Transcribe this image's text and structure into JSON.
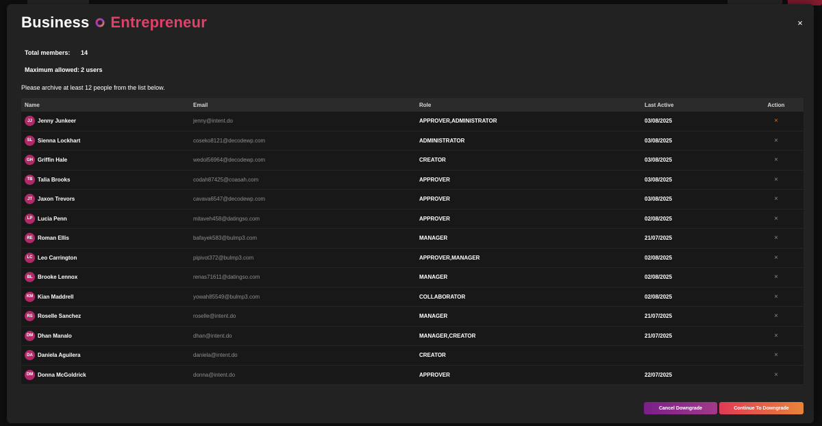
{
  "header": {
    "title_main": "Business",
    "title_accent": "Entrepreneur",
    "logo_icon": "ring-logo-icon",
    "close_label": "×"
  },
  "stats": {
    "total_label": "Total members:",
    "total_value": "14",
    "max_label": "Maximum allowed:",
    "max_value": "2 users"
  },
  "instruction": "Please archive at least 12 people from the list below.",
  "table": {
    "columns": {
      "name": "Name",
      "email": "Email",
      "role": "Role",
      "last_active": "Last Active",
      "action": "Action"
    },
    "rows": [
      {
        "initials": "JJ",
        "name": "Jenny Junkeer",
        "email": "jenny@intent.do",
        "role": "APPROVER,ADMINISTRATOR",
        "last": "03/08/2025",
        "action": "×"
      },
      {
        "initials": "SL",
        "name": "Sienna Lockhart",
        "email": "coseko8121@decodewp.com",
        "role": "ADMINISTRATOR",
        "last": "03/08/2025",
        "action": "×"
      },
      {
        "initials": "GH",
        "name": "Griffin Hale",
        "email": "wedol56964@decodewp.com",
        "role": "CREATOR",
        "last": "03/08/2025",
        "action": "×"
      },
      {
        "initials": "TB",
        "name": "Talia Brooks",
        "email": "codah87425@coasah.com",
        "role": "APPROVER",
        "last": "03/08/2025",
        "action": "×"
      },
      {
        "initials": "JT",
        "name": "Jaxon Trevors",
        "email": "cavava6547@decodewp.com",
        "role": "APPROVER",
        "last": "03/08/2025",
        "action": "×"
      },
      {
        "initials": "LP",
        "name": "Lucia Penn",
        "email": "mitaveh458@datingso.com",
        "role": "APPROVER",
        "last": "02/08/2025",
        "action": "×"
      },
      {
        "initials": "RE",
        "name": "Roman Ellis",
        "email": "bafayek583@bulmp3.com",
        "role": "MANAGER",
        "last": "21/07/2025",
        "action": "×"
      },
      {
        "initials": "LC",
        "name": "Leo Carrington",
        "email": "pipivot372@bulmp3.com",
        "role": "APPROVER,MANAGER",
        "last": "02/08/2025",
        "action": "×"
      },
      {
        "initials": "BL",
        "name": "Brooke Lennox",
        "email": "renas71611@datingso.com",
        "role": "MANAGER",
        "last": "02/08/2025",
        "action": "×"
      },
      {
        "initials": "KM",
        "name": "Kian Maddrell",
        "email": "yowah85549@bulmp3.com",
        "role": "COLLABORATOR",
        "last": "02/08/2025",
        "action": "×"
      },
      {
        "initials": "RS",
        "name": "Roselle Sanchez",
        "email": "roselle@intent.do",
        "role": "MANAGER",
        "last": "21/07/2025",
        "action": "×"
      },
      {
        "initials": "DM",
        "name": "Dhan Manalo",
        "email": "dhan@intent.do",
        "role": "MANAGER,CREATOR",
        "last": "21/07/2025",
        "action": "×"
      },
      {
        "initials": "DA",
        "name": "Daniela Aguilera",
        "email": "daniela@intent.do",
        "role": "CREATOR",
        "last": "",
        "action": "×"
      },
      {
        "initials": "DM",
        "name": "Donna McGoldrick",
        "email": "donna@intent.do",
        "role": "APPROVER",
        "last": "22/07/2025",
        "action": "×"
      }
    ]
  },
  "buttons": {
    "cancel": "Cancel Downgrade",
    "continue": "Continue To Downgrade"
  },
  "colors": {
    "accent": "#e0416a",
    "avatar": "#b12a68",
    "action_highlight": "#e66a2a"
  }
}
